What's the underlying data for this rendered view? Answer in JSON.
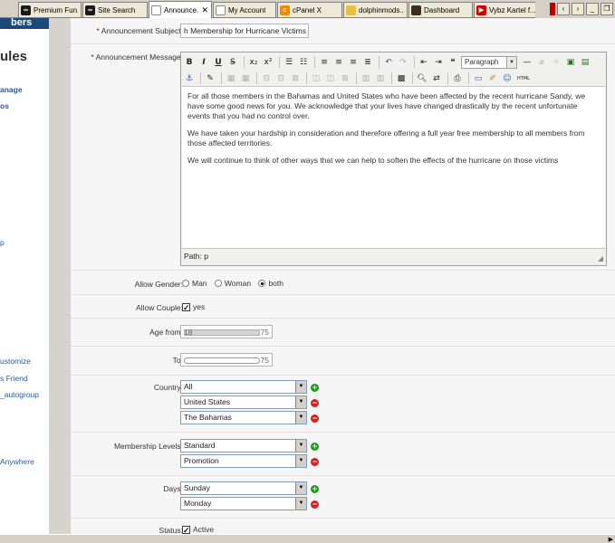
{
  "tabs": [
    {
      "label": "Premium Fun...",
      "icon": "dark-app-icon",
      "active": false
    },
    {
      "label": "Site Search",
      "icon": "dark-app-icon",
      "active": false
    },
    {
      "label": "Announce...",
      "icon": "page-icon",
      "active": true,
      "close": "✕"
    },
    {
      "label": "My Account",
      "icon": "page-icon",
      "active": false
    },
    {
      "label": "cPanel X",
      "icon": "cpanel-icon",
      "active": false
    },
    {
      "label": "dolphinmods...",
      "icon": "dolphin-icon",
      "active": false
    },
    {
      "label": "Dashboard",
      "icon": "dashboard-icon",
      "active": false
    },
    {
      "label": "Vybz Kartel f...",
      "icon": "youtube-icon",
      "active": false
    }
  ],
  "sidebar": {
    "header_cut": "bers",
    "heading": "ules",
    "links": [
      {
        "label": "anage",
        "bold": true
      },
      {
        "label": "os",
        "bold": true
      },
      {
        "label": "p",
        "bold": false
      },
      {
        "label": "ustomize",
        "bold": false
      },
      {
        "label": "s Friend",
        "bold": false
      },
      {
        "label": "_autogroup",
        "bold": false
      },
      {
        "label": "Anywhere",
        "bold": false
      }
    ]
  },
  "form": {
    "subject": {
      "label": "Announcement Subject:",
      "required_mark": "*",
      "value": "h Membership for Hurricane Victims"
    },
    "message": {
      "label": "Announcement Message:",
      "required_mark": "*",
      "format_select": "Paragraph",
      "paragraphs": [
        "For all those members in the Bahamas and United States who have been affected by the recent hurricane Sandy, we have some good news for you. We acknowledge that your lives have changed drastically by the recent unfortunate events that you had no control over.",
        "We have taken your hardship in consideration and therefore offering a full year free membership to all members from those affected territories.",
        "We will continue to think of other ways that we can help to soften the effects of the hurricane on those victims"
      ],
      "path": "Path: p"
    },
    "gender": {
      "label": "Allow Gender:",
      "options": [
        "Man",
        "Woman",
        "both"
      ],
      "selected": "both"
    },
    "couple": {
      "label": "Allow Couple:",
      "option": "yes",
      "checked": true
    },
    "age_from": {
      "label": "Age from:",
      "min": "18",
      "max": "75"
    },
    "age_to": {
      "label": "To:",
      "max": "75"
    },
    "country": {
      "label": "Country:",
      "values": [
        "All",
        "United States",
        "The Bahamas"
      ]
    },
    "membership": {
      "label": "Membership Levels:",
      "values": [
        "Standard",
        "Promotion"
      ]
    },
    "days": {
      "label": "Days:",
      "values": [
        "Sunday",
        "Monday"
      ]
    },
    "status": {
      "label": "Status:",
      "option": "Active",
      "checked": true
    }
  },
  "colors": {
    "plus": "#1e9a1e",
    "minus": "#d42020",
    "link": "#2458a6"
  }
}
